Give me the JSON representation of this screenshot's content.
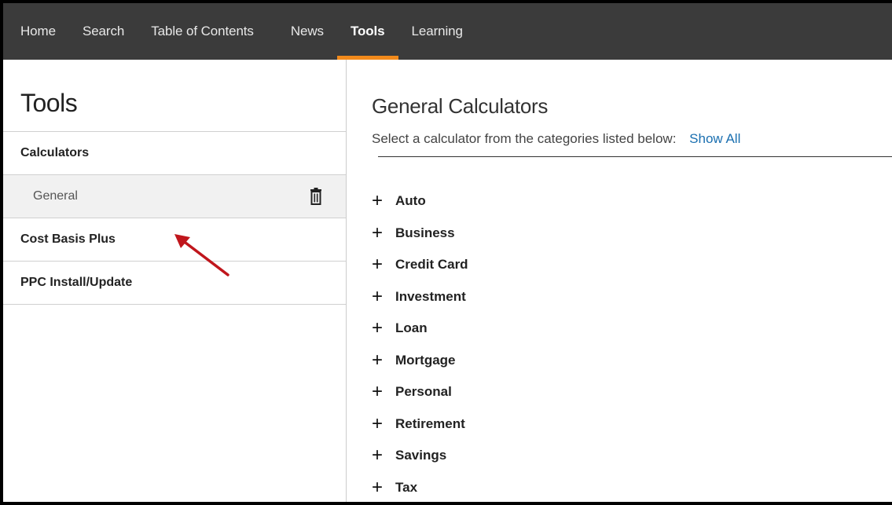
{
  "nav": {
    "items": [
      {
        "label": "Home",
        "active": false
      },
      {
        "label": "Search",
        "active": false
      },
      {
        "label": "Table of Contents",
        "active": false
      },
      {
        "label": "News",
        "active": false
      },
      {
        "label": "Tools",
        "active": true
      },
      {
        "label": "Learning",
        "active": false
      }
    ],
    "accent_color": "#f28a1b"
  },
  "sidebar": {
    "title": "Tools",
    "items": [
      {
        "label": "Calculators"
      },
      {
        "label": "General",
        "icon": "trash-icon"
      },
      {
        "label": "Cost Basis Plus"
      },
      {
        "label": "PPC Install/Update"
      }
    ],
    "annotation_icon": "red-arrow-icon"
  },
  "main": {
    "title": "General Calculators",
    "subtitle": "Select a calculator from the categories listed below:",
    "show_all_label": "Show All",
    "expand_icon": "+",
    "categories": [
      "Auto",
      "Business",
      "Credit Card",
      "Investment",
      "Loan",
      "Mortgage",
      "Personal",
      "Retirement",
      "Savings",
      "Tax"
    ]
  }
}
